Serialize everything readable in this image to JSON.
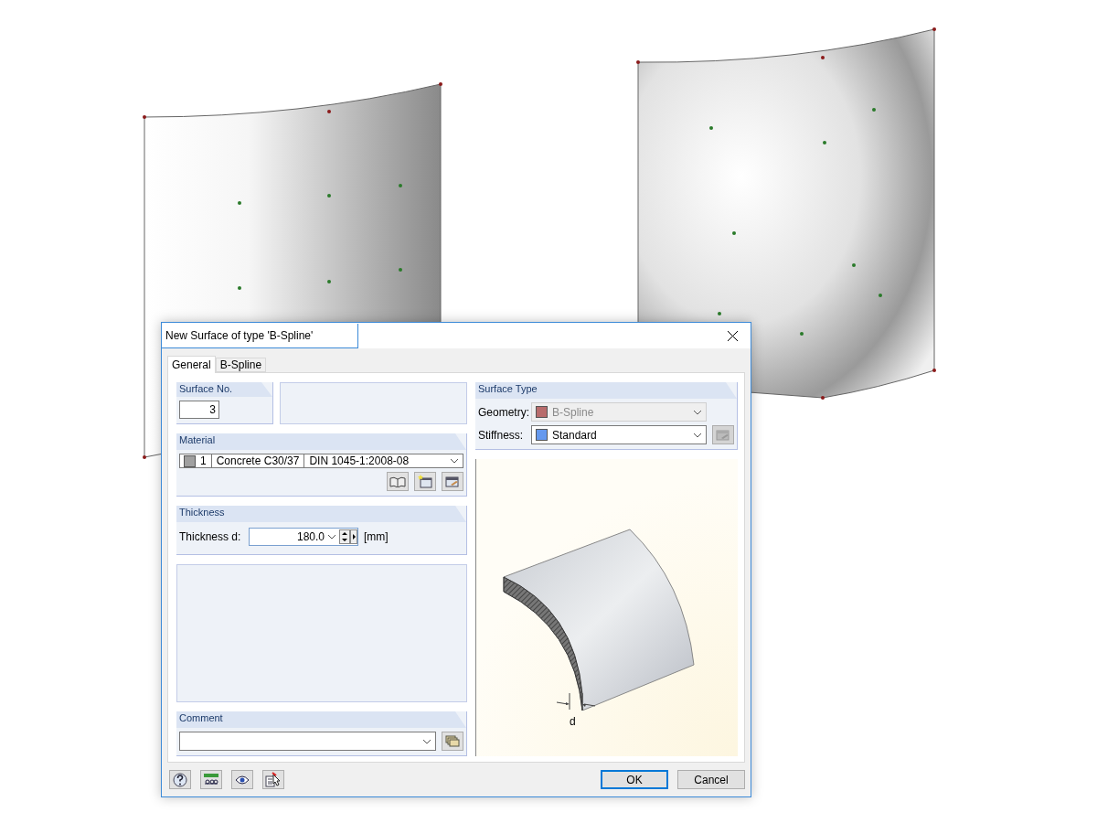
{
  "window": {
    "title": "New Surface of type 'B-Spline'"
  },
  "tabs": [
    {
      "label": "General",
      "selected": true
    },
    {
      "label": "B-Spline",
      "selected": false
    }
  ],
  "surface_no": {
    "label": "Surface No.",
    "value": "3"
  },
  "material": {
    "label": "Material",
    "number": "1",
    "name": "Concrete C30/37",
    "standard": "DIN 1045-1:2008-08"
  },
  "thickness": {
    "label": "Thickness",
    "field_label": "Thickness d:",
    "value": "180.0",
    "unit": "[mm]"
  },
  "comment": {
    "label": "Comment"
  },
  "surface_type": {
    "label": "Surface Type",
    "rows": [
      {
        "label": "Geometry:",
        "value": "B-Spline",
        "color": "#b86c6c",
        "disabled": true
      },
      {
        "label": "Stiffness:",
        "value": "Standard",
        "color": "#6699ee",
        "disabled": false
      }
    ]
  },
  "figure": {
    "dimension_label": "d"
  },
  "buttons": [
    {
      "label": "OK",
      "default": true
    },
    {
      "label": "Cancel",
      "default": false
    }
  ]
}
